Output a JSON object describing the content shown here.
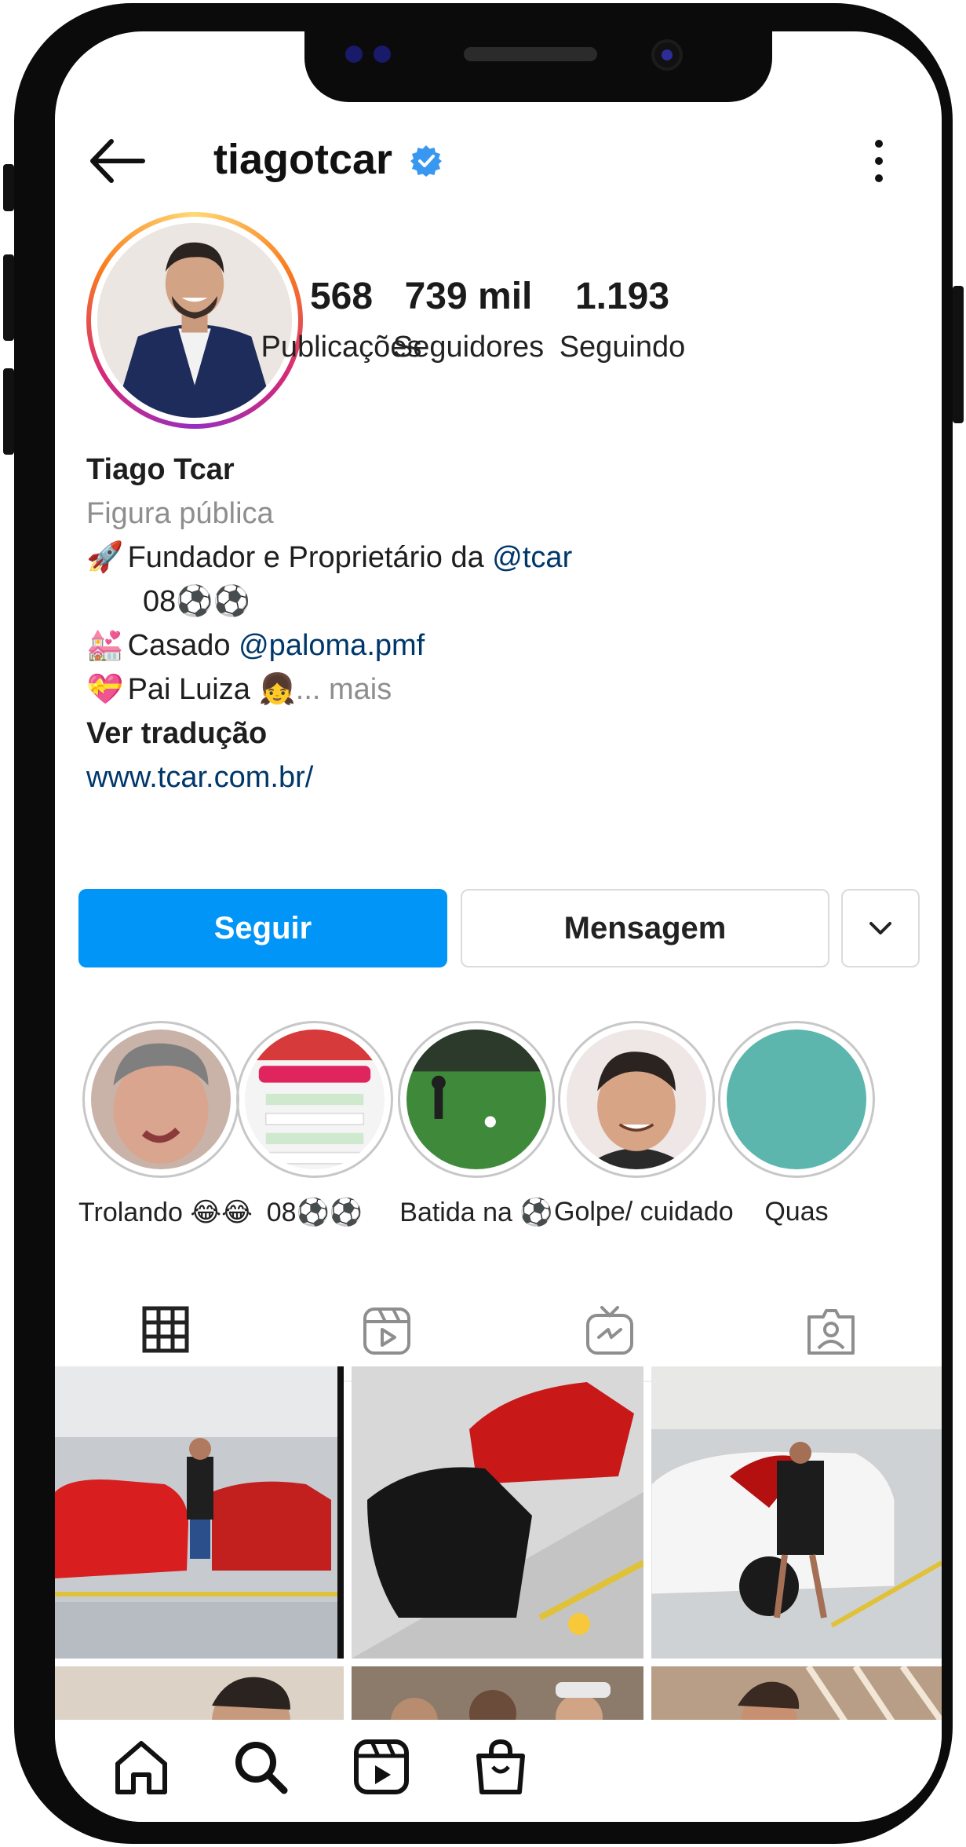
{
  "profile": {
    "username": "tiagotcar",
    "stats": [
      {
        "value": "568",
        "label": "Publicações"
      },
      {
        "value": "739 mil",
        "label": "Seguidores"
      },
      {
        "value": "1.193",
        "label": "Seguindo"
      }
    ],
    "name": "Tiago Tcar",
    "category": "Figura pública",
    "bio": {
      "line1_emoji": "🚀",
      "line1_text": "Fundador e Proprietário da ",
      "line1_mention": "@tcar",
      "line2_text": "08⚽⚽",
      "line3_emoji": "💒",
      "line3_text": "Casado ",
      "line3_mention": "@paloma.pmf",
      "line4_emoji": "💝",
      "line4_text": "Pai Luiza 👧",
      "line4_more": "... mais",
      "translate": "Ver tradução",
      "website": "www.tcar.com.br/"
    }
  },
  "actions": {
    "follow": "Seguir",
    "message": "Mensagem"
  },
  "highlights": [
    {
      "label": "Trolando 😂😂"
    },
    {
      "label": "08⚽⚽"
    },
    {
      "label": "Batida na ⚽"
    },
    {
      "label": "Golpe/ cuidado"
    },
    {
      "label": "Quas"
    }
  ],
  "colors": {
    "accent": "#0095f6",
    "link": "#00376b",
    "verified": "#3897f0"
  },
  "icons": {
    "header": [
      "back-arrow-icon",
      "verified-badge-icon",
      "more-options-icon"
    ],
    "tabs": [
      "grid-icon",
      "reels-icon",
      "igtv-icon",
      "tagged-icon"
    ],
    "nav": [
      "home-icon",
      "search-icon",
      "reels-icon",
      "shop-icon"
    ]
  }
}
